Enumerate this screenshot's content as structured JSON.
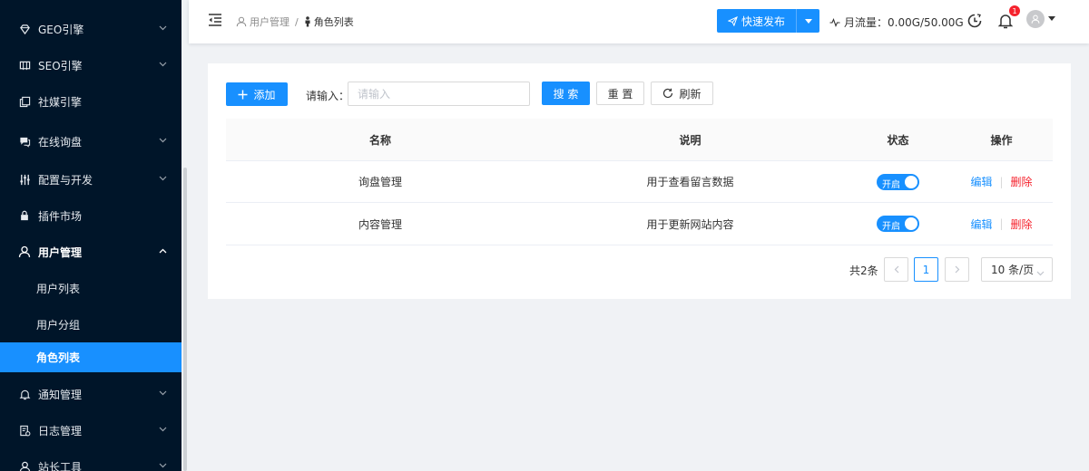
{
  "sidebar": {
    "items": [
      {
        "label": "GEO引擎",
        "icon": "diamond-icon",
        "chevron": "down"
      },
      {
        "label": "SEO引擎",
        "icon": "bookmark-icon",
        "chevron": "down"
      },
      {
        "label": "社媒引擎",
        "icon": "copy-icon",
        "chevron": ""
      },
      {
        "label": "在线询盘",
        "icon": "chat-icon",
        "chevron": "down"
      },
      {
        "label": "配置与开发",
        "icon": "sliders-icon",
        "chevron": "down"
      },
      {
        "label": "插件市场",
        "icon": "lock-icon",
        "chevron": ""
      },
      {
        "label": "用户管理",
        "icon": "user-icon",
        "chevron": "up"
      },
      {
        "label": "通知管理",
        "icon": "bell-icon",
        "chevron": "down"
      },
      {
        "label": "日志管理",
        "icon": "log-icon",
        "chevron": "down"
      },
      {
        "label": "站长工具",
        "icon": "user-icon",
        "chevron": "down"
      }
    ],
    "sub_items": [
      "用户列表",
      "用户分组",
      "角色列表"
    ],
    "active_sub": "角色列表"
  },
  "header": {
    "breadcrumb": [
      "用户管理",
      "角色列表"
    ],
    "publish_label": "快速发布",
    "flow_label": "月流量：0.00G/50.00G",
    "notification_count": "1"
  },
  "toolbar": {
    "add_label": "添加",
    "input_label": "请输入：",
    "input_placeholder": "请输入",
    "search_label": "搜 索",
    "reset_label": "重 置",
    "refresh_label": "刷新"
  },
  "table": {
    "headers": [
      "名称",
      "说明",
      "状态",
      "操作"
    ],
    "rows": [
      {
        "name": "询盘管理",
        "desc": "用于查看留言数据",
        "status": "开启",
        "edit": "编辑",
        "delete": "删除"
      },
      {
        "name": "内容管理",
        "desc": "用于更新网站内容",
        "status": "开启",
        "edit": "编辑",
        "delete": "删除"
      }
    ]
  },
  "pagination": {
    "total": "共2条",
    "current_page": "1",
    "page_size": "10 条/页"
  },
  "colors": {
    "sidebar_bg": "#001529",
    "primary": "#1890ff",
    "danger": "#f5222d"
  }
}
